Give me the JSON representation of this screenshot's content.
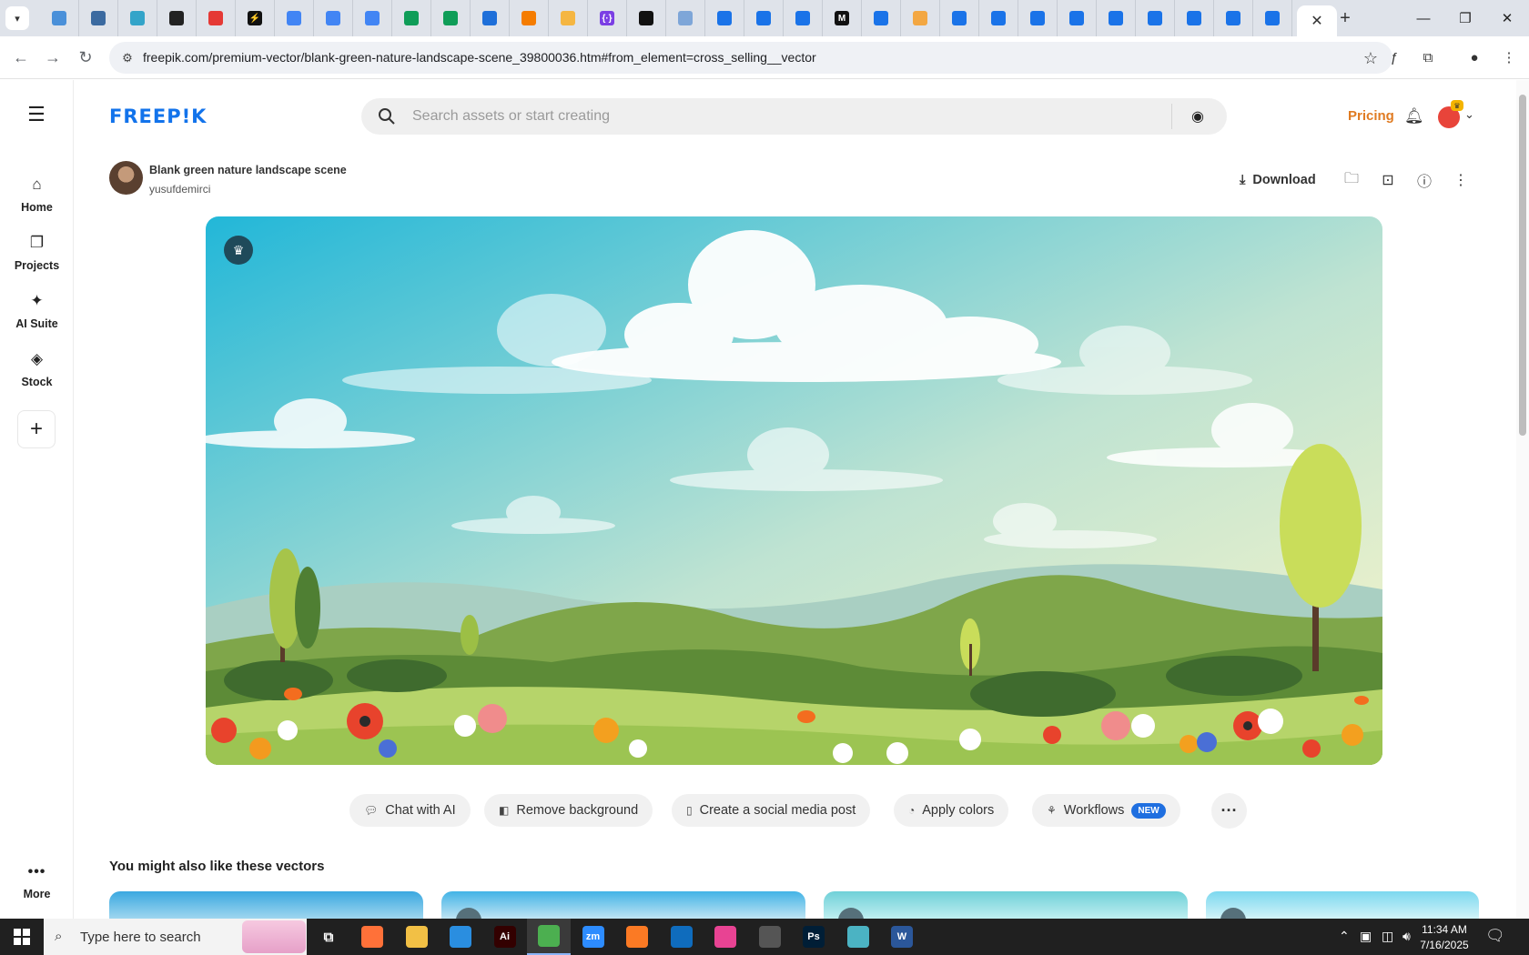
{
  "browser": {
    "active_tab_close": "✕",
    "new_tab": "+",
    "window_controls": {
      "minimize": "—",
      "restore": "❐",
      "close": "✕"
    },
    "url": "freepik.com/premium-vector/blank-green-nature-landscape-scene_39800036.htm#from_element=cross_selling__vector",
    "tab_favicons": [
      {
        "label": "",
        "color": "#4a90d9"
      },
      {
        "label": "",
        "color": "#3b6aa0"
      },
      {
        "label": "",
        "color": "#33a4c9"
      },
      {
        "label": "",
        "color": "#222222"
      },
      {
        "label": "",
        "color": "#e53935"
      },
      {
        "label": "⚡",
        "color": "#111111"
      },
      {
        "label": "",
        "color": "#4285f4"
      },
      {
        "label": "",
        "color": "#4285f4"
      },
      {
        "label": "",
        "color": "#4285f4"
      },
      {
        "label": "",
        "color": "#0f9d58"
      },
      {
        "label": "",
        "color": "#0f9d58"
      },
      {
        "label": "",
        "color": "#1e6fd9"
      },
      {
        "label": "",
        "color": "#f57c00"
      },
      {
        "label": "",
        "color": "#f5b642"
      },
      {
        "label": "{·}",
        "color": "#7b3fe4"
      },
      {
        "label": "",
        "color": "#111111"
      },
      {
        "label": "",
        "color": "#7ea6d8"
      },
      {
        "label": "",
        "color": "#1a73e8"
      },
      {
        "label": "",
        "color": "#1a73e8"
      },
      {
        "label": "",
        "color": "#1a73e8"
      },
      {
        "label": "M",
        "color": "#111111"
      },
      {
        "label": "",
        "color": "#1a73e8"
      },
      {
        "label": "",
        "color": "#f3a742"
      },
      {
        "label": "",
        "color": "#1a73e8"
      },
      {
        "label": "",
        "color": "#1a73e8"
      },
      {
        "label": "",
        "color": "#1a73e8"
      },
      {
        "label": "",
        "color": "#1a73e8"
      },
      {
        "label": "",
        "color": "#1a73e8"
      },
      {
        "label": "",
        "color": "#1a73e8"
      },
      {
        "label": "",
        "color": "#1a73e8"
      },
      {
        "label": "",
        "color": "#1a73e8"
      },
      {
        "label": "",
        "color": "#1a73e8"
      }
    ]
  },
  "rail": {
    "items": [
      {
        "label": "Home",
        "icon": "home-icon"
      },
      {
        "label": "Projects",
        "icon": "projects-icon"
      },
      {
        "label": "AI Suite",
        "icon": "sparkles-icon"
      },
      {
        "label": "Stock",
        "icon": "shapes-icon"
      }
    ],
    "more_label": "More"
  },
  "header": {
    "logo": "FREEP!K",
    "search_placeholder": "Search assets or start creating",
    "pricing": "Pricing"
  },
  "asset": {
    "title": "Blank green nature landscape scene",
    "author": "yusufdemirci",
    "download": "Download"
  },
  "ai_tools": [
    {
      "label": "Chat with AI",
      "icon": "chat-icon"
    },
    {
      "label": "Remove background",
      "icon": "remove-bg-icon"
    },
    {
      "label": "Create a social media post",
      "icon": "phone-icon"
    },
    {
      "label": "Apply colors",
      "icon": "palette-icon"
    },
    {
      "label": "Workflows",
      "icon": "workflow-icon",
      "badge": "NEW"
    }
  ],
  "related_heading": "You might also like these vectors",
  "taskbar": {
    "search_placeholder": "Type here to search",
    "time": "11:34 AM",
    "date": "7/16/2025",
    "apps": [
      {
        "label": "",
        "color": "#ff7139"
      },
      {
        "label": "",
        "color": "#f2c045"
      },
      {
        "label": "",
        "color": "#2a8ee0"
      },
      {
        "label": "Ai",
        "color": "#330000"
      },
      {
        "label": "",
        "color": "#4caf50"
      },
      {
        "label": "zm",
        "color": "#2d8cff"
      },
      {
        "label": "",
        "color": "#fb7a24"
      },
      {
        "label": "",
        "color": "#0f6cbd"
      },
      {
        "label": "",
        "color": "#e84393"
      },
      {
        "label": "",
        "color": "#555555"
      },
      {
        "label": "Ps",
        "color": "#001e36"
      },
      {
        "label": "",
        "color": "#4bb3c3"
      },
      {
        "label": "W",
        "color": "#2b579a"
      }
    ]
  }
}
